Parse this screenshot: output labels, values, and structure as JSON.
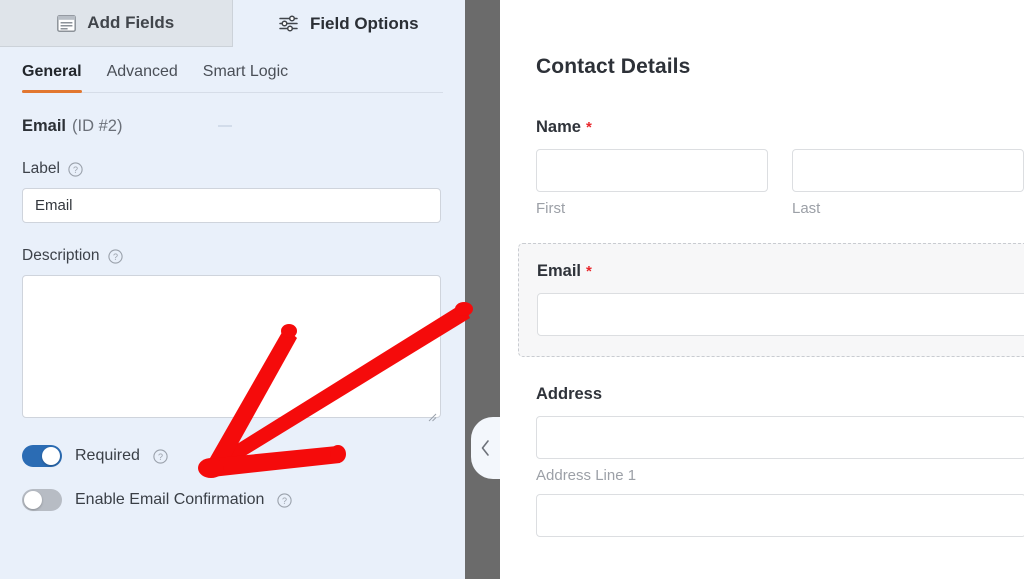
{
  "builder": {
    "main_tabs": [
      {
        "label": "Add Fields",
        "icon": "list-panel-icon",
        "active": false
      },
      {
        "label": "Field Options",
        "icon": "sliders-icon",
        "active": true
      }
    ],
    "sub_tabs": [
      {
        "label": "General",
        "active": true
      },
      {
        "label": "Advanced",
        "active": false
      },
      {
        "label": "Smart Logic",
        "active": false
      }
    ],
    "field_header": {
      "name": "Email",
      "id": "(ID #2)"
    },
    "options": {
      "label_heading": "Label",
      "label_value": "Email",
      "label_placeholder": "",
      "description_heading": "Description",
      "description_value": "",
      "description_placeholder": "",
      "help_icon": "question-circle-icon"
    },
    "toggles": [
      {
        "label": "Required",
        "state": "on",
        "help_icon": "question-circle-icon"
      },
      {
        "label": "Enable Email Confirmation",
        "state": "off",
        "help_icon": "question-circle-icon"
      }
    ],
    "collapse_handle": {
      "icon": "chevron-left-icon"
    }
  },
  "preview": {
    "title": "Contact Details",
    "fields": [
      {
        "label": "Name",
        "required": true,
        "required_mark": "*",
        "selected": false,
        "subfields": [
          {
            "sublabel": "First",
            "value": "",
            "placeholder": ""
          },
          {
            "sublabel": "Last",
            "value": "",
            "placeholder": ""
          }
        ]
      },
      {
        "label": "Email",
        "required": true,
        "required_mark": "*",
        "selected": true,
        "subfields": [
          {
            "sublabel": "",
            "value": "",
            "placeholder": ""
          }
        ]
      },
      {
        "label": "Address",
        "required": false,
        "required_mark": "",
        "selected": false,
        "subfields": [
          {
            "sublabel": "Address Line 1",
            "value": "",
            "placeholder": ""
          },
          {
            "sublabel": "",
            "value": "",
            "placeholder": ""
          }
        ]
      }
    ]
  },
  "annotation": {
    "type": "hand-drawn-arrow",
    "color": "#f50b0b",
    "points_to": "required-toggle"
  },
  "colors": {
    "panel_bg": "#e9f0fa",
    "inactive_tab_bg": "#dfe4ea",
    "accent_orange": "#e27730",
    "toggle_on": "#2b6cb4",
    "toggle_off": "#b7bcc4",
    "divider": "#6b6b6b",
    "required_star": "#e8262b",
    "annotation_red": "#f50b0b"
  }
}
